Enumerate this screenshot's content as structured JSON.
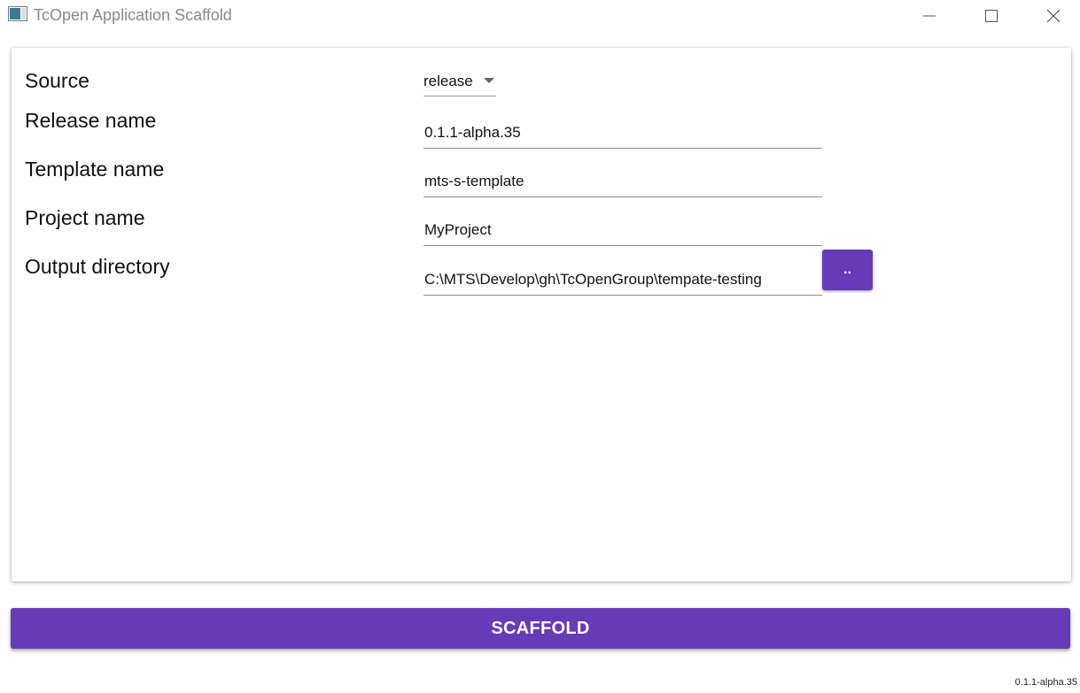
{
  "window": {
    "title": "TcOpen Application Scaffold",
    "icons": {
      "app": "app-window-icon",
      "minimize": "minimize-icon",
      "maximize": "maximize-icon",
      "close": "close-icon"
    }
  },
  "form": {
    "source": {
      "label": "Source",
      "value": "release"
    },
    "release_name": {
      "label": "Release name",
      "value": "0.1.1-alpha.35"
    },
    "template_name": {
      "label": "Template name",
      "value": "mts-s-template"
    },
    "project_name": {
      "label": "Project name",
      "value": "MyProject"
    },
    "output_directory": {
      "label": "Output directory",
      "value": "C:\\MTS\\Develop\\gh\\TcOpenGroup\\tempate-testing",
      "browse_label": ".."
    }
  },
  "actions": {
    "scaffold_label": "SCAFFOLD"
  },
  "footer": {
    "version": "0.1.1-alpha.35"
  },
  "colors": {
    "accent": "#673ab7",
    "title_text": "#8a8a8a",
    "underline": "#8c8c8c"
  }
}
